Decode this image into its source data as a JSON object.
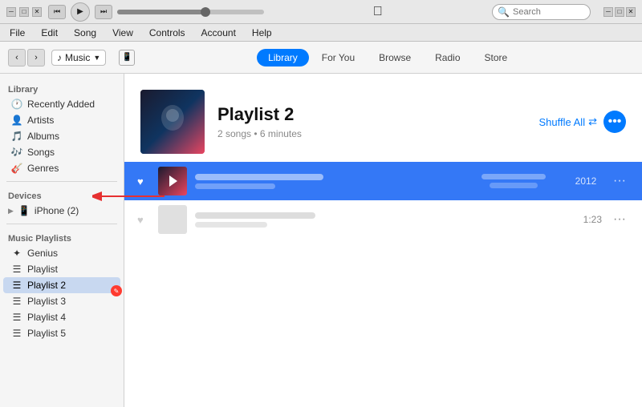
{
  "titleBar": {
    "searchPlaceholder": "Search",
    "winButtons": [
      "minimize",
      "maximize",
      "close"
    ]
  },
  "menuBar": {
    "items": [
      "File",
      "Edit",
      "Song",
      "View",
      "Controls",
      "Account",
      "Help"
    ]
  },
  "toolbar": {
    "backLabel": "‹",
    "forwardLabel": "›",
    "musicLabel": "Music",
    "tabs": [
      {
        "id": "library",
        "label": "Library",
        "active": true
      },
      {
        "id": "for-you",
        "label": "For You",
        "active": false
      },
      {
        "id": "browse",
        "label": "Browse",
        "active": false
      },
      {
        "id": "radio",
        "label": "Radio",
        "active": false
      },
      {
        "id": "store",
        "label": "Store",
        "active": false
      }
    ]
  },
  "sidebar": {
    "libraryTitle": "Library",
    "libraryItems": [
      {
        "id": "recently-added",
        "label": "Recently Added",
        "icon": "🕐"
      },
      {
        "id": "artists",
        "label": "Artists",
        "icon": "👤"
      },
      {
        "id": "albums",
        "label": "Albums",
        "icon": "🎵"
      },
      {
        "id": "songs",
        "label": "Songs",
        "icon": "🎶"
      },
      {
        "id": "genres",
        "label": "Genres",
        "icon": "🎸"
      }
    ],
    "devicesTitle": "Devices",
    "devicesItems": [
      {
        "id": "iphone",
        "label": "iPhone (2)",
        "icon": "📱"
      }
    ],
    "playlistsTitle": "Music Playlists",
    "playlistItems": [
      {
        "id": "genius",
        "label": "Genius",
        "icon": "✦"
      },
      {
        "id": "playlist",
        "label": "Playlist",
        "icon": "☰"
      },
      {
        "id": "playlist2",
        "label": "Playlist 2",
        "icon": "☰",
        "active": true
      },
      {
        "id": "playlist3",
        "label": "Playlist 3",
        "icon": "☰"
      },
      {
        "id": "playlist4",
        "label": "Playlist 4",
        "icon": "☰"
      },
      {
        "id": "playlist5",
        "label": "Playlist 5",
        "icon": "☰"
      }
    ]
  },
  "content": {
    "playlistTitle": "Playlist 2",
    "playlistMeta": "2 songs • 6 minutes",
    "shuffleLabel": "Shuffle All",
    "tracks": [
      {
        "id": "track1",
        "name": "",
        "artist": "",
        "year": "2012",
        "duration": "",
        "playing": true,
        "liked": true
      },
      {
        "id": "track2",
        "name": "",
        "artist": "",
        "year": "",
        "duration": "1:23",
        "playing": false,
        "liked": false
      }
    ]
  }
}
